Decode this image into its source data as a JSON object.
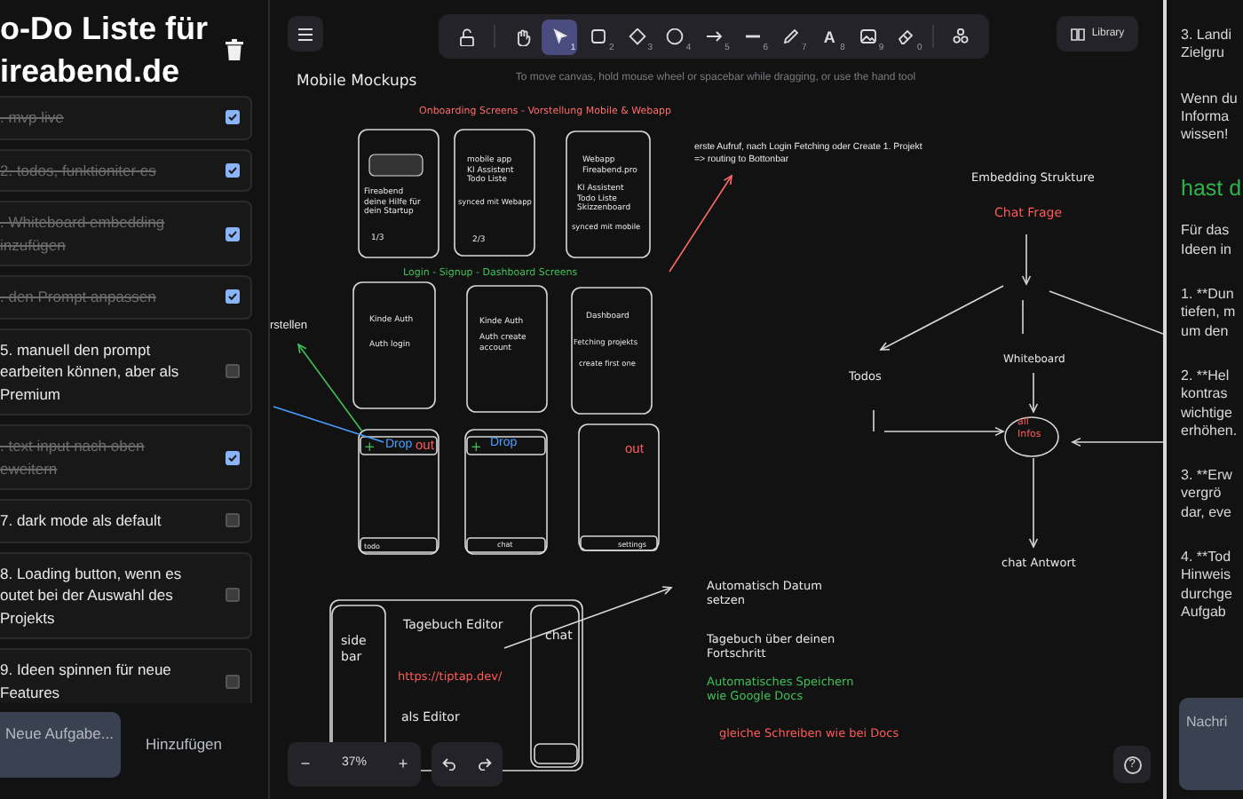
{
  "todo_panel": {
    "title_lines": [
      "o-Do Liste für",
      "ireabend.de"
    ],
    "items": [
      {
        "lines": [
          ". mvp live"
        ],
        "checked": true
      },
      {
        "lines": [
          "2. todos, funktioniter es"
        ],
        "checked": true
      },
      {
        "lines": [
          ". Whiteboard embedding",
          "inzufügen"
        ],
        "checked": true
      },
      {
        "lines": [
          ". den Prompt anpassen"
        ],
        "checked": true
      },
      {
        "lines": [
          "5. manuell den prompt",
          "earbeiten können, aber als",
          "Premium"
        ],
        "checked": false
      },
      {
        "lines": [
          ". text input nach oben",
          "eweitern"
        ],
        "checked": true
      },
      {
        "lines": [
          "7. dark mode als default"
        ],
        "checked": false
      },
      {
        "lines": [
          "8. Loading button, wenn es",
          "outet bei der Auswahl des",
          "Projekts"
        ],
        "checked": false
      },
      {
        "lines": [
          "9. Ideen spinnen für neue",
          "Features"
        ],
        "checked": false
      }
    ],
    "new_task": {
      "placeholder": "Neue Aufgabe..."
    },
    "add_button": "Hinzufügen"
  },
  "canvas": {
    "tools": [
      {
        "kind": "lock",
        "selected": false
      },
      {
        "kind": "hand",
        "selected": false
      },
      {
        "kind": "select",
        "shortcut": "1",
        "selected": true
      },
      {
        "kind": "rectangle",
        "shortcut": "2",
        "selected": false
      },
      {
        "kind": "diamond",
        "shortcut": "3",
        "selected": false
      },
      {
        "kind": "ellipse",
        "shortcut": "4",
        "selected": false
      },
      {
        "kind": "arrow",
        "shortcut": "5",
        "selected": false
      },
      {
        "kind": "line",
        "shortcut": "6",
        "selected": false
      },
      {
        "kind": "pencil",
        "shortcut": "7",
        "selected": false
      },
      {
        "kind": "text",
        "glyph": "A",
        "shortcut": "8",
        "selected": false
      },
      {
        "kind": "image",
        "shortcut": "9",
        "selected": false
      },
      {
        "kind": "eraser",
        "shortcut": "0",
        "selected": false
      },
      {
        "kind": "shapes",
        "selected": false
      }
    ],
    "library_button": "Library",
    "hint": "To move canvas, hold mouse wheel or spacebar while dragging, or use the hand tool",
    "texts": [
      {
        "kind": "hand",
        "text": "Mobile Mockups",
        "color": "#e8e8e8"
      },
      {
        "kind": "hand",
        "text": "Onboarding Screens - Vorstellung Mobile & Webapp",
        "color": "#ff6b6b"
      },
      {
        "kind": "hand",
        "text": "Fireabend\ndeine Hilfe für\ndein Startup"
      },
      {
        "kind": "hand",
        "text": "1/3"
      },
      {
        "kind": "hand",
        "text": "mobile app\nKI Assistent\nTodo Liste"
      },
      {
        "kind": "hand",
        "text": "synced mit Webapp"
      },
      {
        "kind": "hand",
        "text": "2/3"
      },
      {
        "kind": "hand",
        "text": "Webapp\nFireabend.pro"
      },
      {
        "kind": "hand",
        "text": "KI Assistent\nTodo Liste\nSkizzenboard"
      },
      {
        "kind": "hand",
        "text": "synced mit mobile"
      },
      {
        "kind": "hand",
        "text": "Login - Signup - Dashboard Screens",
        "color": "#40c057"
      },
      {
        "kind": "hand",
        "text": "Kinde Auth"
      },
      {
        "kind": "hand",
        "text": "Auth login"
      },
      {
        "kind": "hand",
        "text": "Kinde Auth"
      },
      {
        "kind": "hand",
        "text": "Auth create\naccount"
      },
      {
        "kind": "hand",
        "text": "Dashboard"
      },
      {
        "kind": "hand",
        "text": "Fetching projekts"
      },
      {
        "kind": "hand",
        "text": "create first one"
      },
      {
        "kind": "plain",
        "text": "rstellen"
      },
      {
        "kind": "hand",
        "text": "+",
        "color": "#40c057"
      },
      {
        "kind": "plain",
        "text": "Drop",
        "color": "#4a9eff"
      },
      {
        "kind": "plain",
        "text": "out",
        "color": "#ff5a5a"
      },
      {
        "kind": "hand",
        "text": "+",
        "color": "#40c057"
      },
      {
        "kind": "plain",
        "text": "Drop",
        "color": "#4a9eff"
      },
      {
        "kind": "plain",
        "text": "out",
        "color": "#ff5a5a"
      },
      {
        "kind": "hand",
        "text": "todo"
      },
      {
        "kind": "hand",
        "text": "chat"
      },
      {
        "kind": "hand",
        "text": "settings"
      },
      {
        "kind": "plain",
        "text": "erste Aufruf, nach Login Fetching oder Create 1. Projekt\n=> routing to Bottonbar"
      },
      {
        "kind": "hand",
        "text": "side\nbar"
      },
      {
        "kind": "hand",
        "text": "Tagebuch Editor"
      },
      {
        "kind": "hand",
        "text": "https://tiptap.dev/",
        "color": "#ff5a5a"
      },
      {
        "kind": "hand",
        "text": "als Editor"
      },
      {
        "kind": "hand",
        "text": "chat"
      },
      {
        "kind": "hand",
        "text": "Automatisch Datum\nsetzen"
      },
      {
        "kind": "hand",
        "text": "Tagebuch über deinen\nFortschritt"
      },
      {
        "kind": "hand",
        "text": "Automatisches Speichern\nwie Google Docs",
        "color": "#40c057"
      },
      {
        "kind": "hand",
        "text": "gleiche Schreiben wie bei Docs",
        "color": "#ff5a5a"
      },
      {
        "kind": "hand",
        "text": "Embedding Strukture"
      },
      {
        "kind": "hand",
        "text": "Chat Frage",
        "color": "#ff5a5a"
      },
      {
        "kind": "hand",
        "text": "Todos"
      },
      {
        "kind": "hand",
        "text": "Whiteboard"
      },
      {
        "kind": "hand",
        "text": "all\nInfos",
        "color": "#ff5a5a"
      },
      {
        "kind": "hand",
        "text": "chat Antwort"
      }
    ],
    "zoom": {
      "minus": "−",
      "level": "37%",
      "plus": "+"
    },
    "help_button": {
      "glyph": "?"
    }
  },
  "chat_panel": {
    "blocks": [
      {
        "kind": "text",
        "lines": [
          "3. Landi",
          "Zielgru"
        ]
      },
      {
        "kind": "text",
        "lines": [
          "Wenn du",
          "Informa",
          "wissen!"
        ]
      },
      {
        "kind": "heading",
        "lines": [
          "hast d"
        ]
      },
      {
        "kind": "text",
        "lines": [
          "Für das",
          "Ideen in"
        ]
      },
      {
        "kind": "text",
        "lines": [
          "1. **Dun",
          "tiefen, m",
          "um den"
        ]
      },
      {
        "kind": "text",
        "lines": [
          "2. **Hel",
          "kontras",
          "wichtige",
          "erhöhen."
        ]
      },
      {
        "kind": "text",
        "lines": [
          "3. **Erw",
          "vergrö",
          "dar, eve"
        ]
      },
      {
        "kind": "text",
        "lines": [
          "4. **Tod",
          "Hinweis",
          "durchge",
          "Aufgab"
        ]
      }
    ],
    "input": {
      "placeholder": "Nachri"
    }
  }
}
